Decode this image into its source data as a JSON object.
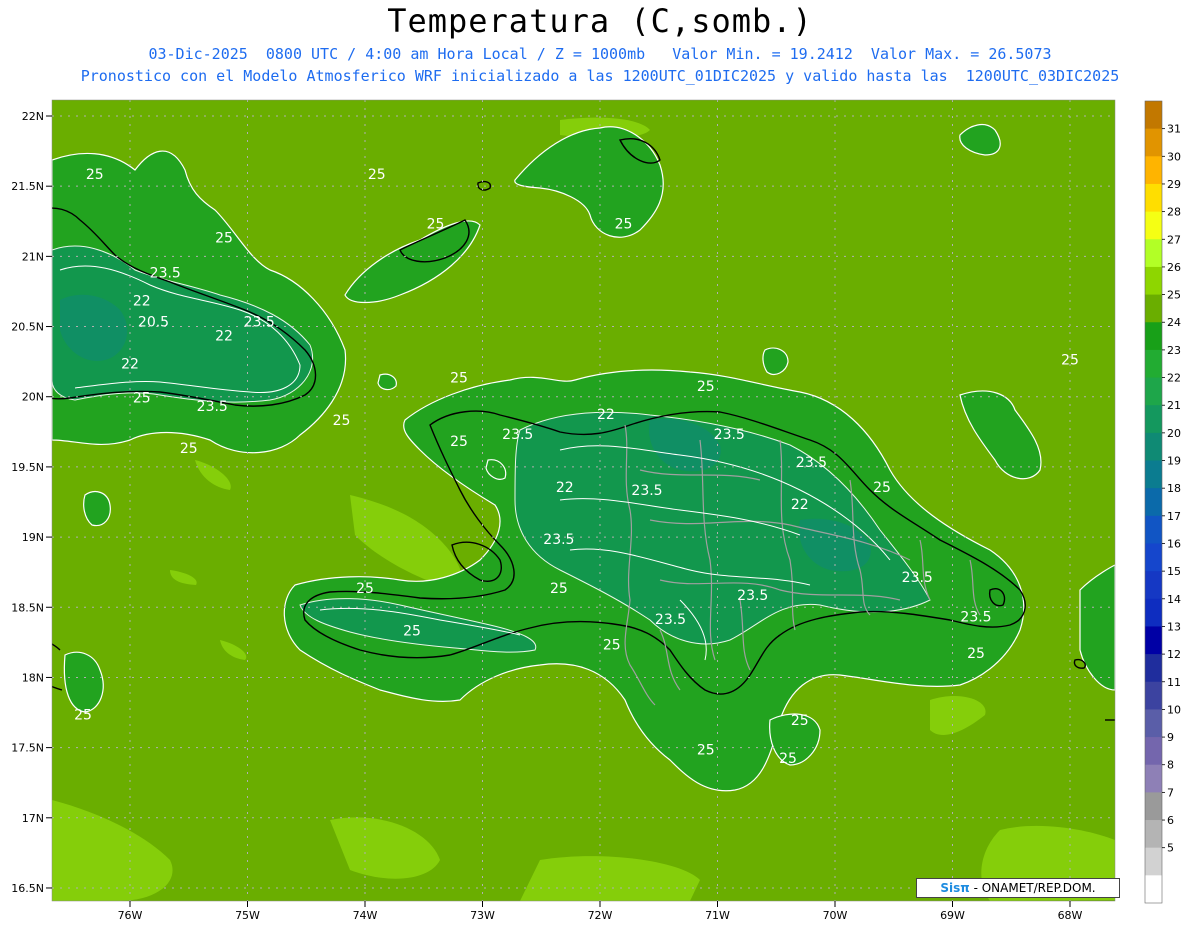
{
  "title": "Temperatura (C,somb.)",
  "subtitle_line1": "03-Dic-2025  0800 UTC / 4:00 am Hora Local / Z = 1000mb   Valor Min. = 19.2412  Valor Max. = 26.5073",
  "subtitle_line2": "Pronostico con el Modelo Atmosferico WRF inicializado a las 1200UTC_01DIC2025 y valido hasta las  1200UTC_03DIC2025",
  "credit": {
    "logo": "Sisπ",
    "text": " - ONAMET/REP.DOM."
  },
  "colors": {
    "background_field": "#6aae00",
    "land_warm": "#22a31f",
    "land_cool": "#119652",
    "coast": "#000000",
    "contour": "#ffffff",
    "border": "#a0a0a0",
    "title_blue": "#1e6cf0"
  },
  "map": {
    "lat_labels": [
      "22N",
      "21.5N",
      "21N",
      "20.5N",
      "20N",
      "19.5N",
      "19N",
      "18.5N",
      "18N",
      "17.5N",
      "17N",
      "16.5N"
    ],
    "lon_labels": [
      "76W",
      "75W",
      "74W",
      "73W",
      "72W",
      "71W",
      "70W",
      "69W",
      "68W"
    ],
    "contour_labels": [
      {
        "text": "25",
        "lon": -76.3,
        "lat": 21.55
      },
      {
        "text": "25",
        "lon": -73.9,
        "lat": 21.55
      },
      {
        "text": "25",
        "lon": -73.4,
        "lat": 21.2
      },
      {
        "text": "25",
        "lon": -71.8,
        "lat": 21.2
      },
      {
        "text": "25",
        "lon": -75.2,
        "lat": 21.1
      },
      {
        "text": "23.5",
        "lon": -75.7,
        "lat": 20.85
      },
      {
        "text": "22",
        "lon": -75.9,
        "lat": 20.65
      },
      {
        "text": "20.5",
        "lon": -75.8,
        "lat": 20.5
      },
      {
        "text": "22",
        "lon": -75.2,
        "lat": 20.4
      },
      {
        "text": "23.5",
        "lon": -74.9,
        "lat": 20.5
      },
      {
        "text": "22",
        "lon": -76.0,
        "lat": 20.2
      },
      {
        "text": "25",
        "lon": -75.9,
        "lat": 19.96
      },
      {
        "text": "23.5",
        "lon": -75.3,
        "lat": 19.9
      },
      {
        "text": "25",
        "lon": -74.2,
        "lat": 19.8
      },
      {
        "text": "25",
        "lon": -75.5,
        "lat": 19.6
      },
      {
        "text": "25",
        "lon": -73.2,
        "lat": 20.1
      },
      {
        "text": "25",
        "lon": -71.1,
        "lat": 20.04
      },
      {
        "text": "25",
        "lon": -73.2,
        "lat": 19.65
      },
      {
        "text": "23.5",
        "lon": -72.7,
        "lat": 19.7
      },
      {
        "text": "22",
        "lon": -71.95,
        "lat": 19.84
      },
      {
        "text": "23.5",
        "lon": -70.9,
        "lat": 19.7
      },
      {
        "text": "23.5",
        "lon": -70.2,
        "lat": 19.5
      },
      {
        "text": "22",
        "lon": -72.3,
        "lat": 19.32
      },
      {
        "text": "23.5",
        "lon": -71.6,
        "lat": 19.3
      },
      {
        "text": "22",
        "lon": -70.3,
        "lat": 19.2
      },
      {
        "text": "25",
        "lon": -69.6,
        "lat": 19.32
      },
      {
        "text": "23.5",
        "lon": -72.35,
        "lat": 18.95
      },
      {
        "text": "23.5",
        "lon": -69.3,
        "lat": 18.68
      },
      {
        "text": "25",
        "lon": -68.0,
        "lat": 20.23
      },
      {
        "text": "25",
        "lon": -67.5,
        "lat": 19.48
      },
      {
        "text": "25",
        "lon": -74.0,
        "lat": 18.6
      },
      {
        "text": "25",
        "lon": -72.35,
        "lat": 18.6
      },
      {
        "text": "23.5",
        "lon": -70.7,
        "lat": 18.55
      },
      {
        "text": "23.5",
        "lon": -71.4,
        "lat": 18.38
      },
      {
        "text": "25",
        "lon": -73.6,
        "lat": 18.3
      },
      {
        "text": "25",
        "lon": -71.9,
        "lat": 18.2
      },
      {
        "text": "23.5",
        "lon": -68.8,
        "lat": 18.4
      },
      {
        "text": "25",
        "lon": -68.8,
        "lat": 18.14
      },
      {
        "text": "25",
        "lon": -70.3,
        "lat": 17.66
      },
      {
        "text": "25",
        "lon": -71.1,
        "lat": 17.45
      },
      {
        "text": "25",
        "lon": -70.4,
        "lat": 17.39
      },
      {
        "text": "25",
        "lon": -76.4,
        "lat": 17.7
      }
    ]
  },
  "colorbar": {
    "labels": [
      "31",
      "30",
      "29",
      "28",
      "27",
      "26",
      "25",
      "24",
      "23",
      "22",
      "21",
      "20",
      "19",
      "18",
      "17",
      "16",
      "15",
      "14",
      "13",
      "12",
      "11",
      "10",
      "9",
      "8",
      "7",
      "6",
      "5"
    ],
    "colors": [
      "#c27800",
      "#e19400",
      "#ffb400",
      "#ffde00",
      "#f5ff14",
      "#b2ff26",
      "#8ed600",
      "#6aae00",
      "#18a018",
      "#22ac32",
      "#1ea64a",
      "#14985e",
      "#0f8a74",
      "#0b7c90",
      "#0b6aaa",
      "#1155c4",
      "#1546cc",
      "#1538c4",
      "#0e2dc0",
      "#0000a5",
      "#1f2d9d",
      "#3c43a0",
      "#5a5ea8",
      "#7466ad",
      "#8e80b6",
      "#9a9a9a",
      "#b4b4b4",
      "#d2d2d2",
      "#ffffff"
    ]
  }
}
